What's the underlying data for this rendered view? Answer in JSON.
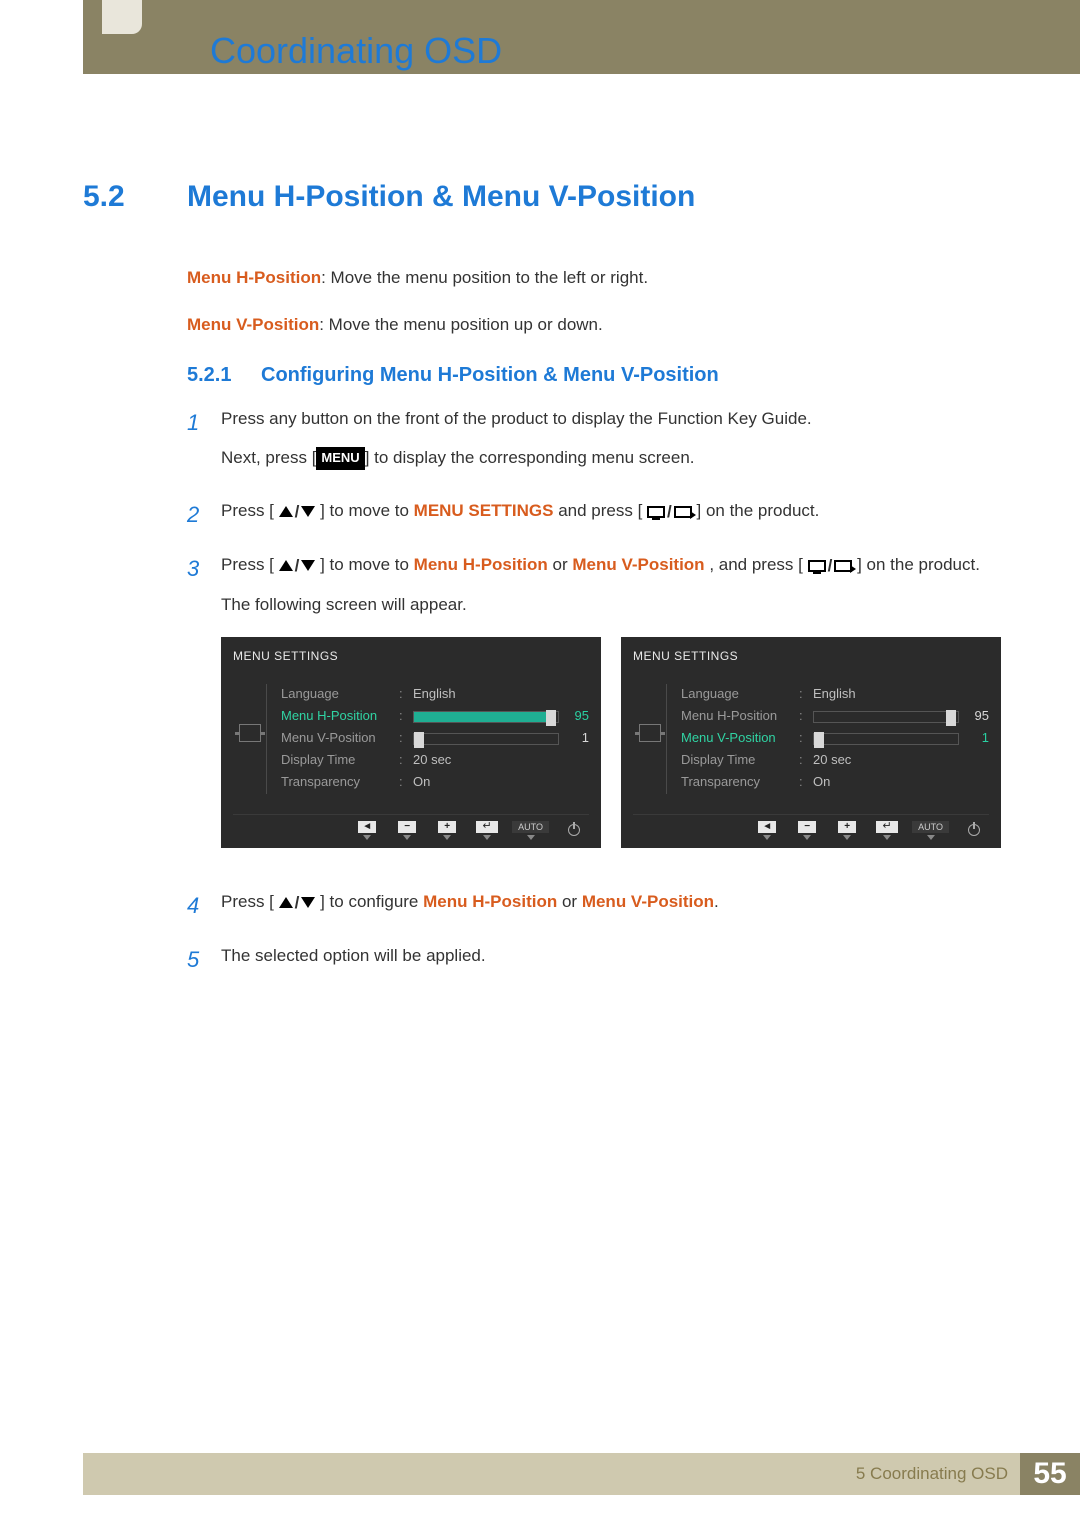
{
  "chapter": {
    "title": "Coordinating OSD"
  },
  "section": {
    "number": "5.2",
    "title": "Menu H-Position & Menu V-Position"
  },
  "intro": {
    "h_label": "Menu H-Position",
    "h_desc": ": Move the menu position to the left or right.",
    "v_label": "Menu V-Position",
    "v_desc": ": Move the menu position up or down."
  },
  "subsection": {
    "number": "5.2.1",
    "title": "Configuring Menu H-Position & Menu V-Position"
  },
  "steps": {
    "s1": {
      "n": "1",
      "a": "Press any button on the front of the product to display the Function Key Guide.",
      "b_pre": "Next, press [",
      "b_key": "MENU",
      "b_post": "] to display the corresponding menu screen."
    },
    "s2": {
      "n": "2",
      "pre": "Press [",
      "mid": "] to move to ",
      "hl": "MENU SETTINGS",
      "post1": " and press [",
      "post2": "] on the product."
    },
    "s3": {
      "n": "3",
      "pre": "Press [",
      "mid": "] to move to ",
      "hl1": "Menu H-Position",
      "or": " or ",
      "hl2": "Menu V-Position",
      "post1": ", and press [",
      "post2": "] on the product.",
      "tail": "The following screen will appear."
    },
    "s4": {
      "n": "4",
      "pre": "Press [",
      "mid": "] to configure ",
      "hl1": "Menu H-Position",
      "or": " or ",
      "hl2": "Menu V-Position",
      "end": "."
    },
    "s5": {
      "n": "5",
      "text": "The selected option will be applied."
    }
  },
  "osd": {
    "header": "MENU SETTINGS",
    "rows": {
      "language": {
        "label": "Language",
        "value": "English"
      },
      "hpos": {
        "label": "Menu H-Position",
        "value": "95"
      },
      "vpos": {
        "label": "Menu V-Position",
        "value": "1"
      },
      "dtime": {
        "label": "Display Time",
        "value": "20 sec"
      },
      "transp": {
        "label": "Transparency",
        "value": "On"
      }
    },
    "footer": {
      "auto": "AUTO",
      "back": "◄",
      "minus": "−",
      "plus": "+"
    }
  },
  "footer": {
    "label": "5 Coordinating OSD",
    "page": "55"
  }
}
